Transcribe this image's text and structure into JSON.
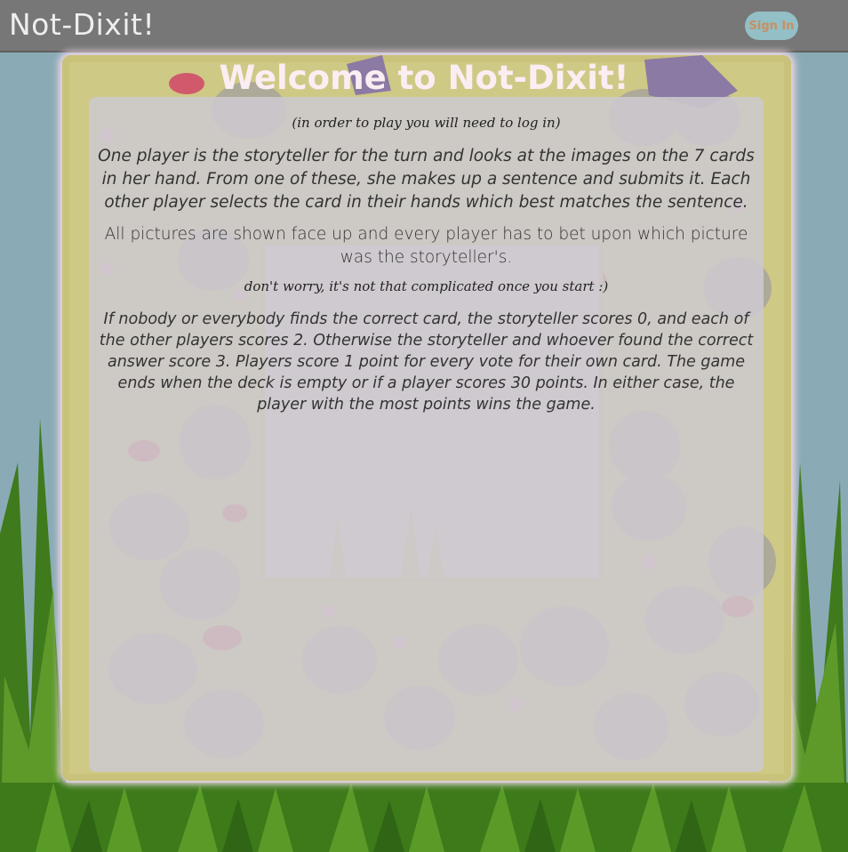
{
  "header": {
    "brand": "Not-Dixit!",
    "sign_in_label": "Sign In"
  },
  "main": {
    "title": "Welcome to Not-Dixit!",
    "login_note": "(in order to play you will need to log in)",
    "rules_1": "One player is the storyteller for the turn and looks at the images on the 7 cards in her hand. From one of these, she makes up a sentence and submits it. Each other player selects the card in their hands which best matches the sentence.",
    "rules_2": "All pictures are shown face up and every player has to bet upon which picture was the storyteller's.",
    "reassure_note": "don't worry, it's not that complicated once you start :)",
    "rules_3": "If nobody or everybody finds the correct card, the storyteller scores 0, and each of the other players scores 2. Otherwise the storyteller and whoever found the correct answer score 3. Players score 1 point for every vote for their own card. The game ends when the deck is empty or if a player scores 30 points. In either case, the player with the most points wins the game."
  },
  "colors": {
    "header_bg": "#777777",
    "sky": "#8aabb6",
    "grass": "#4f8a24",
    "board": "#c9c27a",
    "panel": "#cdc8ce",
    "sign_in_bg": "#93bfc6",
    "sign_in_text": "#c79063"
  }
}
